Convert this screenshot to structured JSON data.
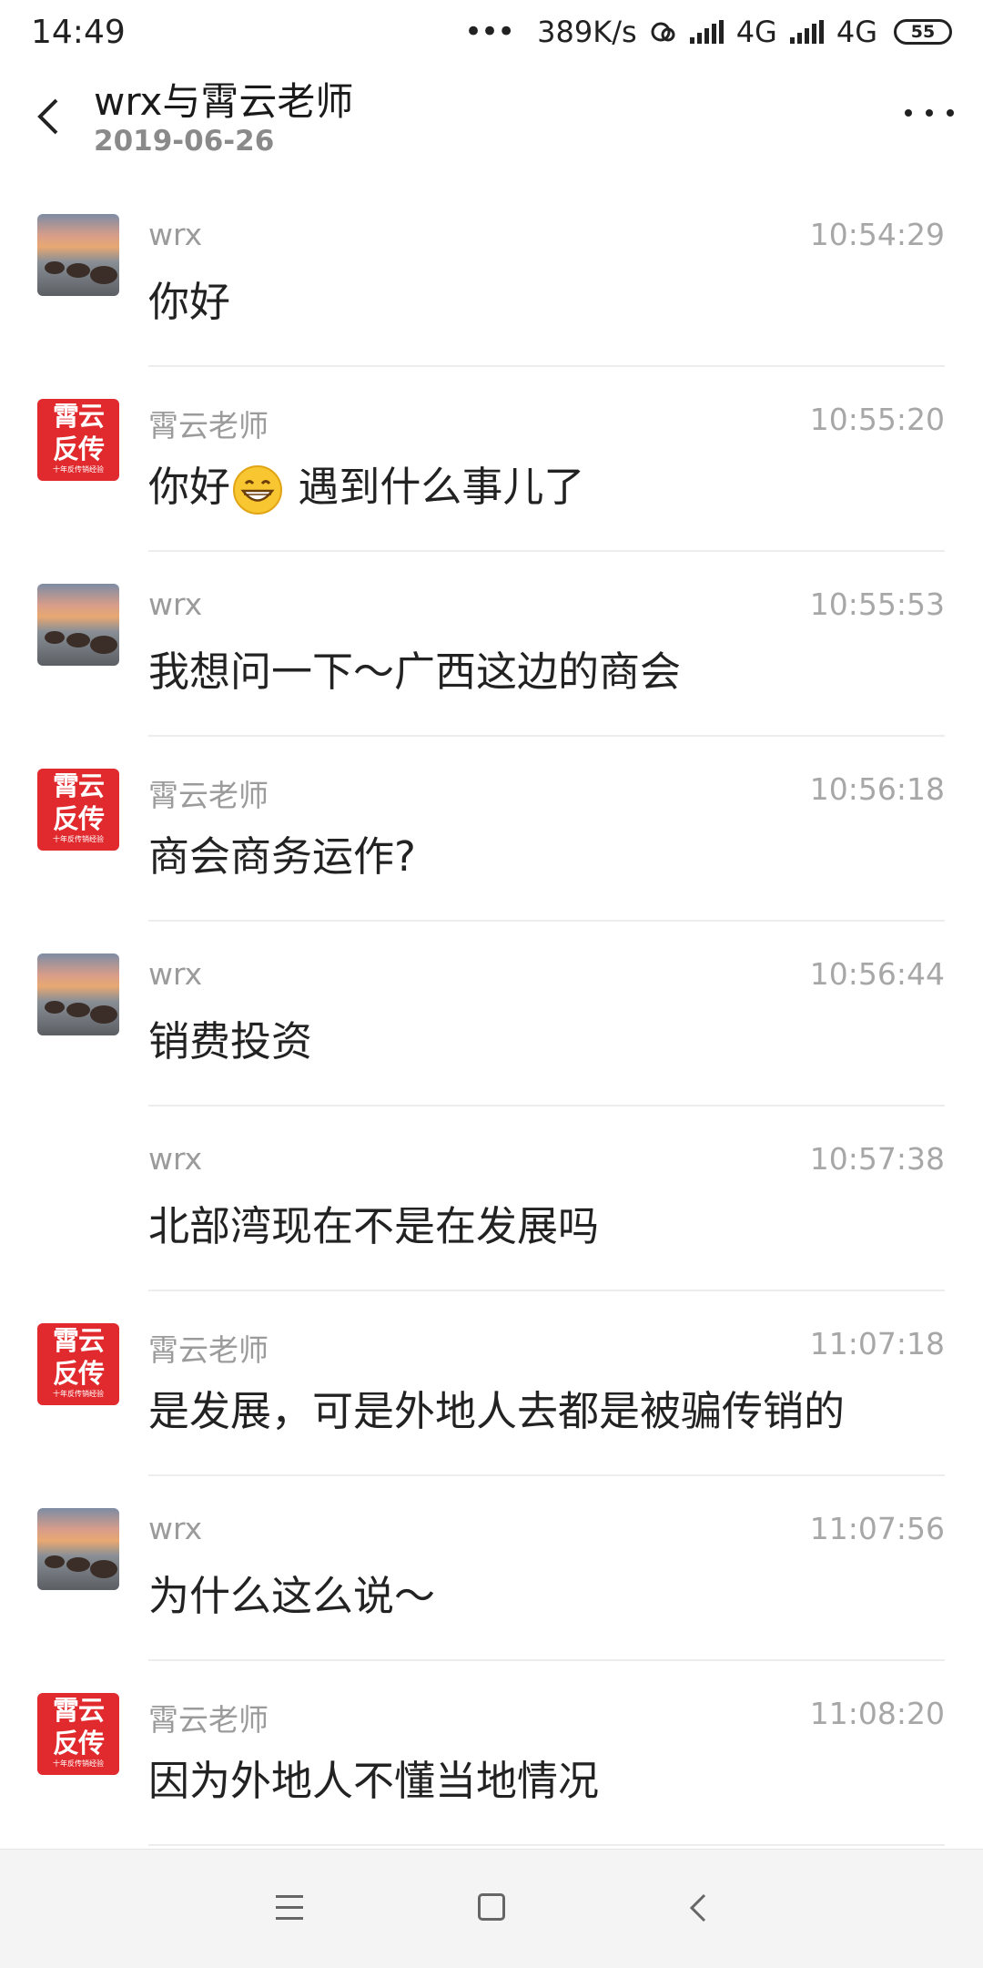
{
  "status_bar": {
    "time": "14:49",
    "speed": "389K/s",
    "net1": "4G",
    "net2": "4G",
    "battery": "55"
  },
  "header": {
    "title": "wrx与霄云老师",
    "subtitle": "2019-06-26"
  },
  "messages": [
    {
      "avatar": "landscape-photo",
      "sender": "wrx",
      "time": "10:54:29",
      "text": "你好"
    },
    {
      "avatar": "brand-logo",
      "sender": "霄云老师",
      "time": "10:55:20",
      "text_before": "你好",
      "emoji": "grinning-face",
      "text_after": " 遇到什么事儿了"
    },
    {
      "avatar": "landscape-photo",
      "sender": "wrx",
      "time": "10:55:53",
      "text": "我想问一下～广西这边的商会"
    },
    {
      "avatar": "brand-logo",
      "sender": "霄云老师",
      "time": "10:56:18",
      "text": "商会商务运作?"
    },
    {
      "avatar": "landscape-photo",
      "sender": "wrx",
      "time": "10:56:44",
      "text": "销费投资"
    },
    {
      "avatar": "none",
      "sender": "wrx",
      "time": "10:57:38",
      "text": "北部湾现在不是在发展吗"
    },
    {
      "avatar": "brand-logo",
      "sender": "霄云老师",
      "time": "11:07:18",
      "text": "是发展，可是外地人去都是被骗传销的"
    },
    {
      "avatar": "landscape-photo",
      "sender": "wrx",
      "time": "11:07:56",
      "text": "为什么这么说～"
    },
    {
      "avatar": "brand-logo",
      "sender": "霄云老师",
      "time": "11:08:20",
      "text": "因为外地人不懂当地情况"
    }
  ],
  "brand_avatar": {
    "line1": "霄云",
    "line2": "反传",
    "tagline": "十年反传销经验"
  },
  "nav_bar": {
    "icons": [
      "menu-icon",
      "home-icon",
      "back-icon"
    ]
  },
  "colors": {
    "brand_red": "#e02a2e",
    "time_gray": "#a7a7a7",
    "divider": "#ededed",
    "nav_bg": "#f4f4f4"
  }
}
